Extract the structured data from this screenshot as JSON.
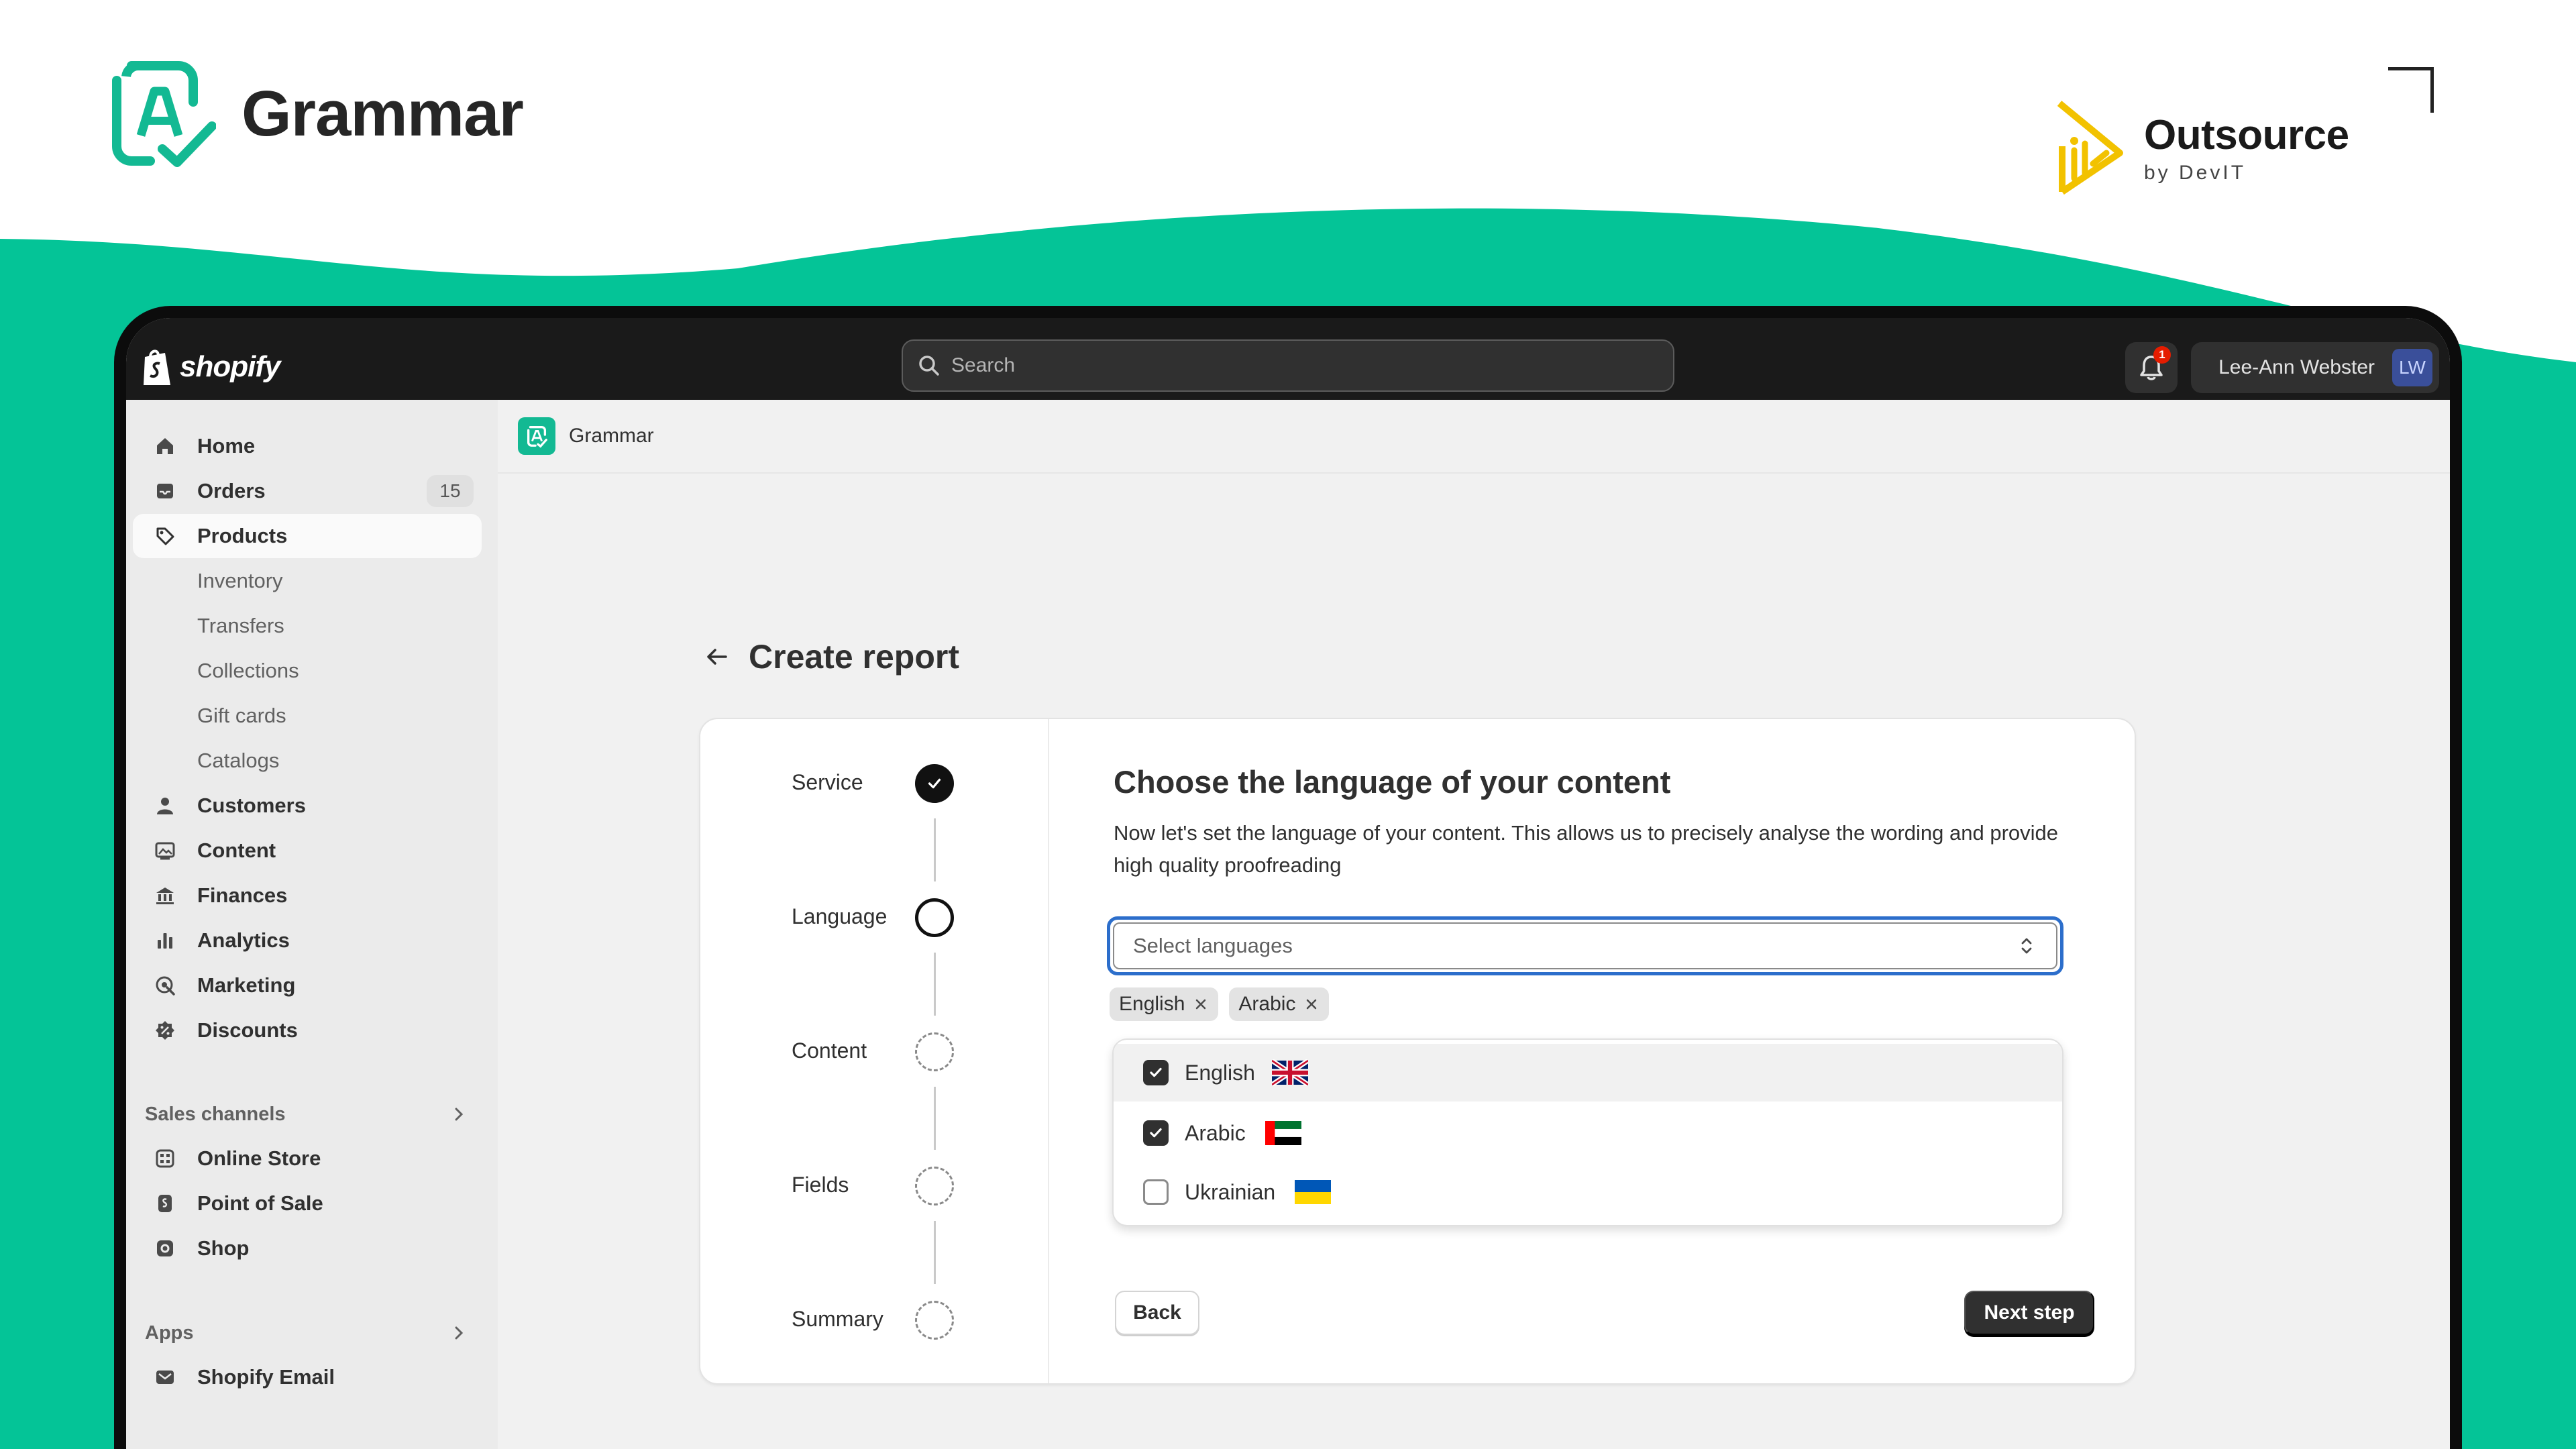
{
  "colors": {
    "brand_teal": "#04c497",
    "shopify_dark": "#1a1a1a",
    "focus_blue": "#2c6ecb",
    "partner_yellow": "#f2c200"
  },
  "marketing": {
    "brand_name": "Grammar",
    "partner_name": "Outsource",
    "partner_sub": "by DevIT"
  },
  "topbar": {
    "logo_text": "shopify",
    "search_placeholder": "Search",
    "notification_count": "1",
    "user_name": "Lee-Ann Webster",
    "user_initials": "LW"
  },
  "sidebar": {
    "items": [
      {
        "label": "Home",
        "icon": "home-icon"
      },
      {
        "label": "Orders",
        "icon": "inbox-icon",
        "count": "15"
      },
      {
        "label": "Products",
        "icon": "tag-icon",
        "active": true
      },
      {
        "label": "Inventory",
        "sub": true
      },
      {
        "label": "Transfers",
        "sub": true
      },
      {
        "label": "Collections",
        "sub": true
      },
      {
        "label": "Gift cards",
        "sub": true
      },
      {
        "label": "Catalogs",
        "sub": true
      },
      {
        "label": "Customers",
        "icon": "person-icon"
      },
      {
        "label": "Content",
        "icon": "image-icon"
      },
      {
        "label": "Finances",
        "icon": "bank-icon"
      },
      {
        "label": "Analytics",
        "icon": "bar-chart-icon"
      },
      {
        "label": "Marketing",
        "icon": "target-icon"
      },
      {
        "label": "Discounts",
        "icon": "discount-icon"
      }
    ],
    "sales_channels_label": "Sales channels",
    "sales_channels": [
      {
        "label": "Online Store",
        "icon": "store-icon"
      },
      {
        "label": "Point of Sale",
        "icon": "pos-icon"
      },
      {
        "label": "Shop",
        "icon": "shop-icon"
      }
    ],
    "apps_label": "Apps",
    "apps": [
      {
        "label": "Shopify Email",
        "icon": "email-icon"
      }
    ]
  },
  "main": {
    "app_name": "Grammar",
    "page_title": "Create report",
    "steps": [
      {
        "label": "Service",
        "state": "done"
      },
      {
        "label": "Language",
        "state": "current"
      },
      {
        "label": "Content",
        "state": "todo"
      },
      {
        "label": "Fields",
        "state": "todo"
      },
      {
        "label": "Summary",
        "state": "todo"
      }
    ],
    "question_title": "Choose the language of your content",
    "question_desc": "Now let's set the language of your content. This allows us to precisely analyse the wording and provide high quality proofreading",
    "select_placeholder": "Select languages",
    "selected_tags": [
      "English",
      "Arabic"
    ],
    "options": [
      {
        "label": "English",
        "checked": true,
        "flag": "uk-flag"
      },
      {
        "label": "Arabic",
        "checked": true,
        "flag": "uae-flag"
      },
      {
        "label": "Ukrainian",
        "checked": false,
        "flag": "ukraine-flag"
      }
    ],
    "back_label": "Back",
    "next_label": "Next step"
  }
}
